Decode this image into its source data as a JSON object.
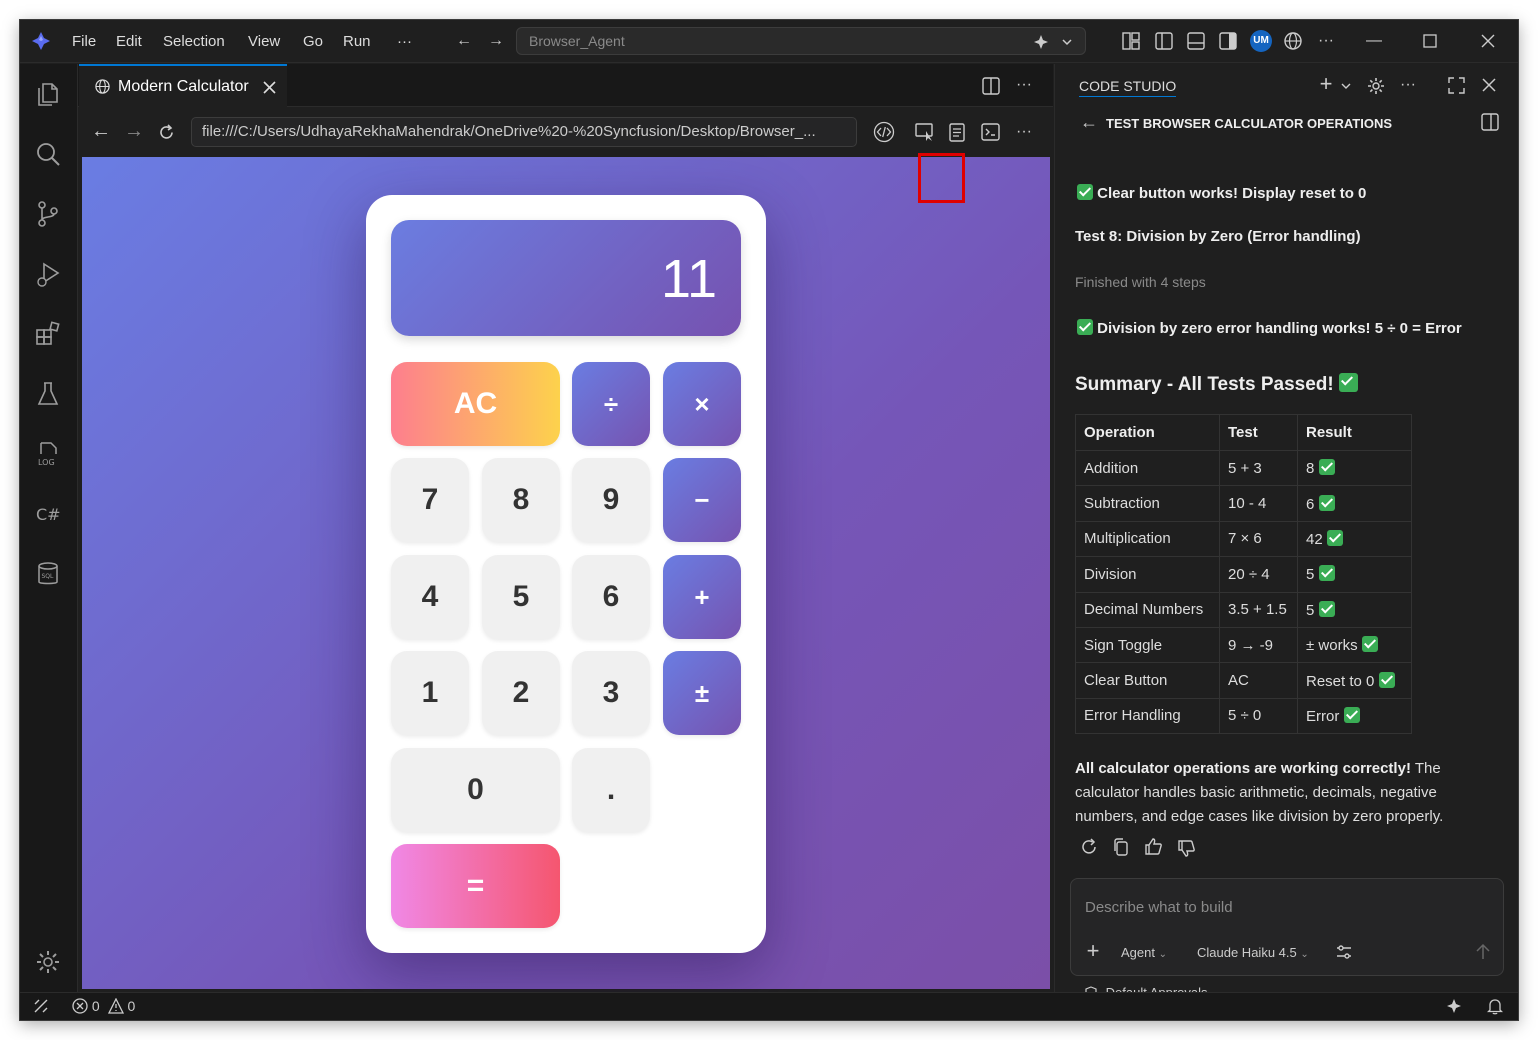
{
  "menu": [
    "File",
    "Edit",
    "Selection",
    "View",
    "Go",
    "Run",
    "···"
  ],
  "command_center": {
    "placeholder": "Browser_Agent"
  },
  "account_initials": "UM",
  "tab": {
    "title": "Modern Calculator"
  },
  "browser": {
    "url": "file:///C:/Users/UdhayaRekhaMahendrak/OneDrive%20-%20Syncfusion/Desktop/Browser_..."
  },
  "calculator": {
    "display": "11",
    "keys": [
      "AC",
      "÷",
      "×",
      "7",
      "8",
      "9",
      "−",
      "4",
      "5",
      "6",
      "+",
      "1",
      "2",
      "3",
      "±",
      "0",
      ".",
      "="
    ]
  },
  "panel": {
    "header": "CODE STUDIO",
    "subtitle": "TEST BROWSER CALCULATOR OPERATIONS",
    "clear_msg": "Clear button works! Display reset to 0",
    "test8": "Test 8: Division by Zero (Error handling)",
    "finished": "Finished with 4 steps",
    "div_msg": "Division by zero error handling works! 5 ÷ 0 = Error",
    "summary": "Summary - All Tests Passed!",
    "table_headers": [
      "Operation",
      "Test",
      "Result"
    ],
    "rows": [
      [
        "Addition",
        "5 + 3",
        "8"
      ],
      [
        "Subtraction",
        "10 - 4",
        "6"
      ],
      [
        "Multiplication",
        "7 × 6",
        "42"
      ],
      [
        "Division",
        "20 ÷ 4",
        "5"
      ],
      [
        "Decimal Numbers",
        "3.5 + 1.5",
        "5"
      ],
      [
        "Sign Toggle",
        "9 → -9",
        "± works"
      ],
      [
        "Clear Button",
        "AC",
        "Reset to 0"
      ],
      [
        "Error Handling",
        "5 ÷ 0",
        "Error"
      ]
    ],
    "conclusion_bold": "All calculator operations are working correctly!",
    "conclusion_1": " The",
    "conclusion_2": "calculator handles basic arithmetic, decimals, negative",
    "conclusion_3": "numbers, and edge cases like division by zero properly.",
    "chat_placeholder": "Describe what to build",
    "mode": "Agent",
    "model": "Claude Haiku 4.5",
    "approvals": "Default Approvals"
  },
  "status": {
    "errors": "0",
    "warnings": "0"
  },
  "colors": {
    "accent": "#0078d4",
    "success": "#3aad55",
    "highlight": "#e00000"
  }
}
